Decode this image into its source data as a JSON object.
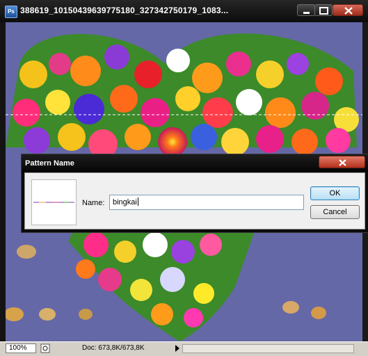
{
  "document": {
    "app_icon_text": "Ps",
    "title": "388619_10150439639775180_327342750179_1083...",
    "zoom": "100%",
    "doc_info": "Doc: 673,8K/673,8K"
  },
  "dialog": {
    "title": "Pattern Name",
    "name_label": "Name:",
    "name_value": "bingkai",
    "ok_label": "OK",
    "cancel_label": "Cancel"
  },
  "icons": [
    "photoshop-app-icon",
    "minimize-icon",
    "maximize-icon",
    "close-icon",
    "status-menu-arrow-icon"
  ],
  "colors": {
    "titlebar": "#0c0c0c",
    "close_red": "#b2301d",
    "dialog_bg": "#f0f0f0",
    "ok_blue": "#b9def5"
  }
}
